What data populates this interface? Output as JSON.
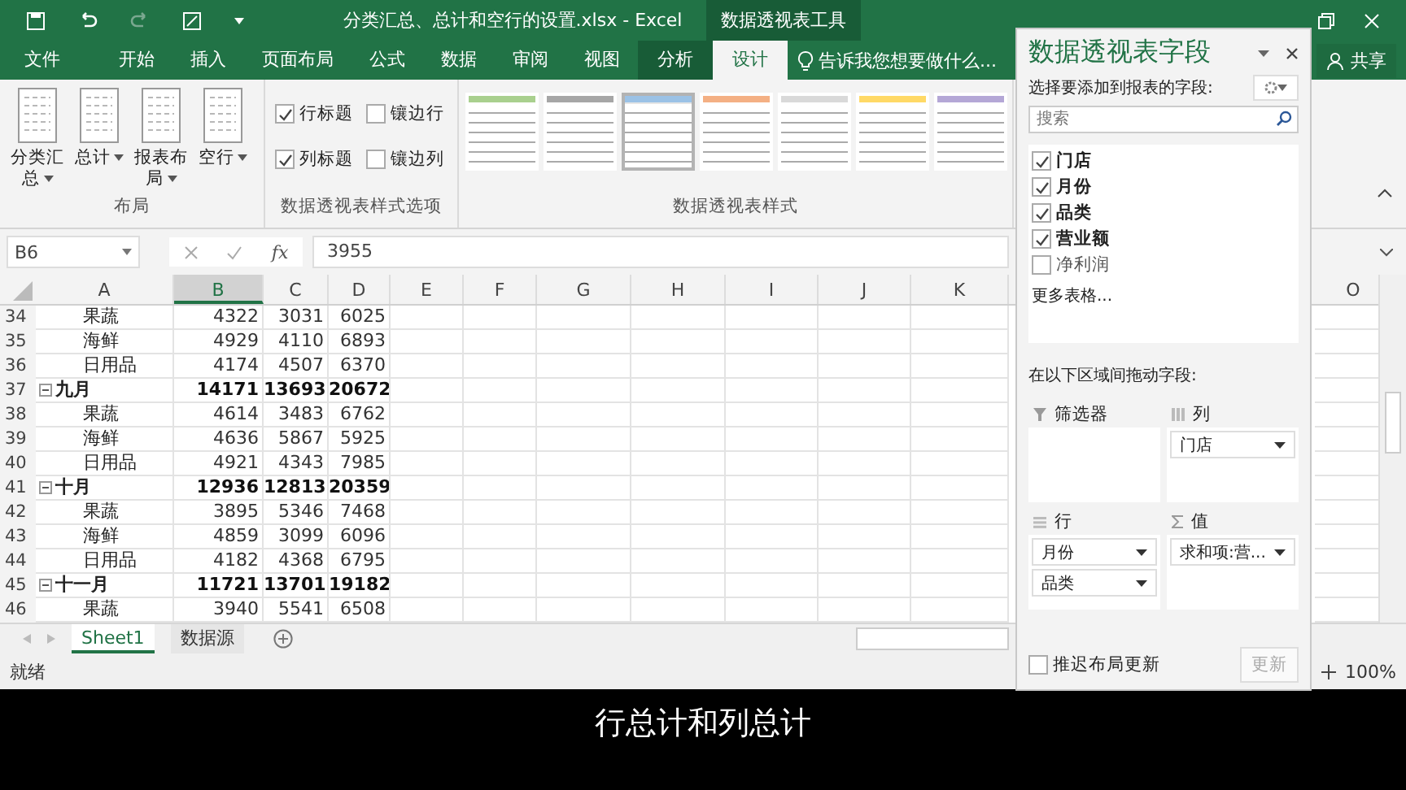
{
  "title_bar": {
    "title": "分类汇总、总计和空行的设置.xlsx - Excel",
    "context_title": "数据透视表工具"
  },
  "tabs": [
    {
      "label": "文件",
      "selected": false,
      "context": false
    },
    {
      "label": "开始",
      "selected": false,
      "context": false
    },
    {
      "label": "插入",
      "selected": false,
      "context": false
    },
    {
      "label": "页面布局",
      "selected": false,
      "context": false
    },
    {
      "label": "公式",
      "selected": false,
      "context": false
    },
    {
      "label": "数据",
      "selected": false,
      "context": false
    },
    {
      "label": "审阅",
      "selected": false,
      "context": false
    },
    {
      "label": "视图",
      "selected": false,
      "context": false
    },
    {
      "label": "分析",
      "selected": false,
      "context": true
    },
    {
      "label": "设计",
      "selected": true,
      "context": true
    }
  ],
  "tell_me": "告诉我您想要做什么...",
  "share": "共享",
  "ribbon": {
    "layout": {
      "caption": "布局",
      "buttons": [
        "分类汇总",
        "总计",
        "报表布局",
        "空行"
      ]
    },
    "style_options": {
      "caption": "数据透视表样式选项",
      "options": [
        {
          "label": "行标题",
          "checked": true
        },
        {
          "label": "镶边行",
          "checked": false
        },
        {
          "label": "列标题",
          "checked": true
        },
        {
          "label": "镶边列",
          "checked": false
        }
      ]
    },
    "styles": {
      "caption": "数据透视表样式",
      "swatches": [
        {
          "color": "#a9d08e",
          "selected": false
        },
        {
          "color": "#a6a6a6",
          "selected": false
        },
        {
          "color": "#9bc2e6",
          "selected": true
        },
        {
          "color": "#f4b084",
          "selected": false
        },
        {
          "color": "#d9d9d9",
          "selected": false
        },
        {
          "color": "#ffd966",
          "selected": false
        },
        {
          "color": "#b4a7d6",
          "selected": false
        }
      ]
    }
  },
  "formula_bar": {
    "name_box": "B6",
    "function_label": "fx",
    "value": "3955"
  },
  "sheet": {
    "columns": [
      {
        "label": "A",
        "selected": false
      },
      {
        "label": "B",
        "selected": true
      },
      {
        "label": "C",
        "selected": false
      },
      {
        "label": "D",
        "selected": false
      },
      {
        "label": "E",
        "selected": false
      },
      {
        "label": "F",
        "selected": false
      },
      {
        "label": "G",
        "selected": false
      },
      {
        "label": "H",
        "selected": false
      },
      {
        "label": "I",
        "selected": false
      },
      {
        "label": "J",
        "selected": false
      },
      {
        "label": "K",
        "selected": false
      },
      {
        "label": "O",
        "selected": false
      }
    ],
    "rows": [
      {
        "num": "34",
        "kind": "item",
        "label": "果蔬",
        "values": [
          "4322",
          "3031",
          "6025"
        ]
      },
      {
        "num": "35",
        "kind": "item",
        "label": "海鲜",
        "values": [
          "4929",
          "4110",
          "6893"
        ]
      },
      {
        "num": "36",
        "kind": "item",
        "label": "日用品",
        "values": [
          "4174",
          "4507",
          "6370"
        ]
      },
      {
        "num": "37",
        "kind": "group",
        "label": "九月",
        "values": [
          "14171",
          "13693",
          "20672"
        ]
      },
      {
        "num": "38",
        "kind": "item",
        "label": "果蔬",
        "values": [
          "4614",
          "3483",
          "6762"
        ]
      },
      {
        "num": "39",
        "kind": "item",
        "label": "海鲜",
        "values": [
          "4636",
          "5867",
          "5925"
        ]
      },
      {
        "num": "40",
        "kind": "item",
        "label": "日用品",
        "values": [
          "4921",
          "4343",
          "7985"
        ]
      },
      {
        "num": "41",
        "kind": "group",
        "label": "十月",
        "values": [
          "12936",
          "12813",
          "20359"
        ]
      },
      {
        "num": "42",
        "kind": "item",
        "label": "果蔬",
        "values": [
          "3895",
          "5346",
          "7468"
        ]
      },
      {
        "num": "43",
        "kind": "item",
        "label": "海鲜",
        "values": [
          "4859",
          "3099",
          "6096"
        ]
      },
      {
        "num": "44",
        "kind": "item",
        "label": "日用品",
        "values": [
          "4182",
          "4368",
          "6795"
        ]
      },
      {
        "num": "45",
        "kind": "group",
        "label": "十一月",
        "values": [
          "11721",
          "13701",
          "19182"
        ]
      },
      {
        "num": "46",
        "kind": "item",
        "label": "果蔬",
        "values": [
          "3940",
          "5541",
          "6508"
        ]
      }
    ]
  },
  "sheet_tabs": [
    {
      "label": "Sheet1",
      "selected": true
    },
    {
      "label": "数据源",
      "selected": false
    }
  ],
  "status_bar": {
    "status": "就绪",
    "zoom": "100%"
  },
  "field_pane": {
    "title": "数据透视表字段",
    "subtitle": "选择要添加到报表的字段:",
    "search_placeholder": "搜索",
    "fields": [
      {
        "label": "门店",
        "checked": true
      },
      {
        "label": "月份",
        "checked": true
      },
      {
        "label": "品类",
        "checked": true
      },
      {
        "label": "营业额",
        "checked": true
      },
      {
        "label": "净利润",
        "checked": false
      }
    ],
    "more_tables": "更多表格...",
    "drag_hint": "在以下区域间拖动字段:",
    "areas": [
      {
        "kind": "filter",
        "label": "筛选器"
      },
      {
        "kind": "columns",
        "label": "列",
        "items": [
          "门店"
        ]
      },
      {
        "kind": "rows",
        "label": "行",
        "items": [
          "月份",
          "品类"
        ]
      },
      {
        "kind": "values",
        "label": "值",
        "items": [
          "求和项:营..."
        ]
      }
    ],
    "defer": {
      "label": "推迟布局更新",
      "checked": false
    },
    "update_button": {
      "label": "更新",
      "disabled": true
    }
  },
  "caption": "行总计和列总计"
}
